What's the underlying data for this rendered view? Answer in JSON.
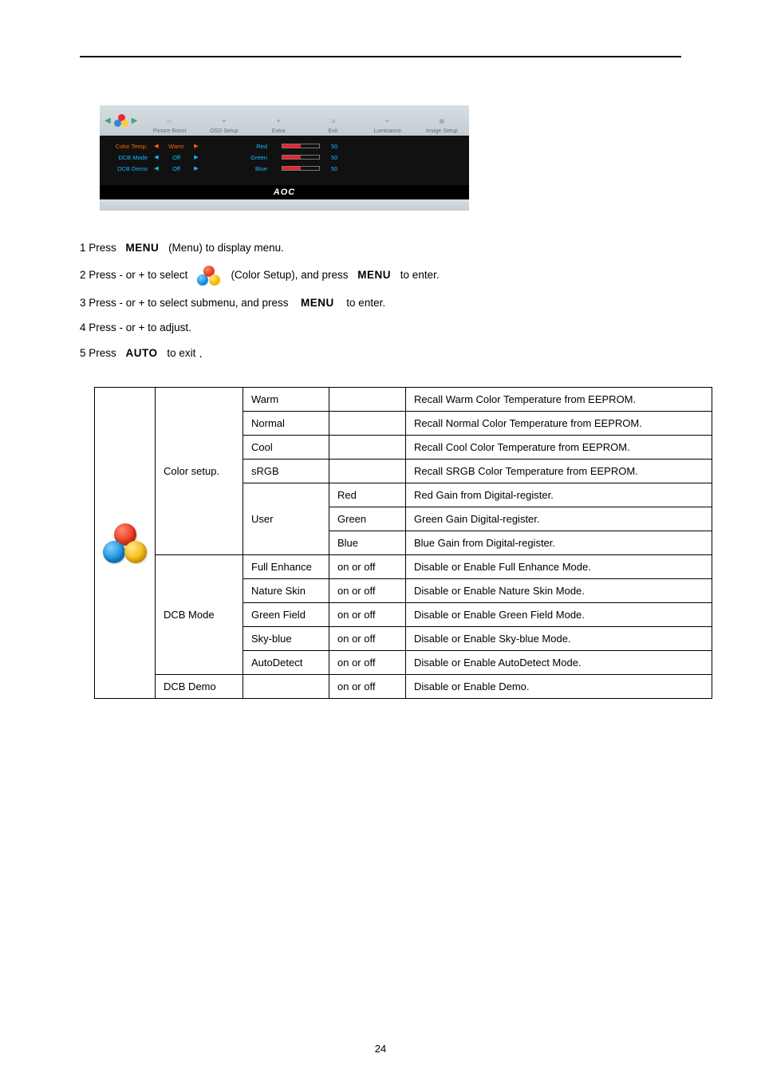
{
  "osd": {
    "tabs": [
      "Picture Boost",
      "OSD Setup",
      "Extra",
      "Exit",
      "Luminance",
      "Image Setup"
    ],
    "rows": [
      {
        "label": "Color Temp.",
        "value": "Warm",
        "rgb": "Red",
        "num": "50",
        "hot": true
      },
      {
        "label": "DCB Mode",
        "value": "Off",
        "rgb": "Green",
        "num": "50",
        "hot": false
      },
      {
        "label": "DCB Demo",
        "value": "Off",
        "rgb": "Blue",
        "num": "50",
        "hot": false
      }
    ],
    "brand": "AOC"
  },
  "steps": {
    "s1a": "1 Press",
    "s1b": "MENU",
    "s1c": "(Menu) to display menu.",
    "s2a": "2 Press - or + to select",
    "s2b": "(Color Setup), and press",
    "s2c": "MENU",
    "s2d": "to enter.",
    "s3a": "3 Press - or + to select submenu, and press",
    "s3b": "MENU",
    "s3c": "to enter.",
    "s4": "4 Press - or + to adjust.",
    "s5a": "5 Press",
    "s5b": "AUTO",
    "s5c": "to exit"
  },
  "table": {
    "group1": "Color setup.",
    "group2": "DCB Mode",
    "group3": "DCB Demo",
    "rows": [
      {
        "c3": "Warm",
        "c4": "",
        "c5": "Recall Warm Color Temperature from EEPROM."
      },
      {
        "c3": "Normal",
        "c4": "",
        "c5": "Recall Normal Color Temperature from EEPROM."
      },
      {
        "c3": "Cool",
        "c4": "",
        "c5": "Recall Cool Color Temperature from EEPROM."
      },
      {
        "c3": "sRGB",
        "c4": "",
        "c5": "Recall SRGB Color Temperature from EEPROM."
      },
      {
        "c3": "User",
        "c4": "Red",
        "c5": "Red Gain from Digital-register."
      },
      {
        "c3": "",
        "c4": "Green",
        "c5": "Green Gain Digital-register."
      },
      {
        "c3": "",
        "c4": "Blue",
        "c5": "Blue Gain from Digital-register."
      },
      {
        "c3": "Full Enhance",
        "c4": "on or off",
        "c5": "Disable or Enable Full Enhance Mode."
      },
      {
        "c3": "Nature Skin",
        "c4": "on or off",
        "c5": "Disable or Enable Nature Skin Mode."
      },
      {
        "c3": "Green Field",
        "c4": "on or off",
        "c5": "Disable or Enable Green Field Mode."
      },
      {
        "c3": "Sky-blue",
        "c4": "on or off",
        "c5": "Disable or Enable Sky-blue Mode."
      },
      {
        "c3": "AutoDetect",
        "c4": "on or off",
        "c5": "Disable or Enable AutoDetect Mode."
      },
      {
        "c3": "",
        "c4": "on or off",
        "c5": "Disable or Enable Demo."
      }
    ]
  },
  "pageNum": "24"
}
